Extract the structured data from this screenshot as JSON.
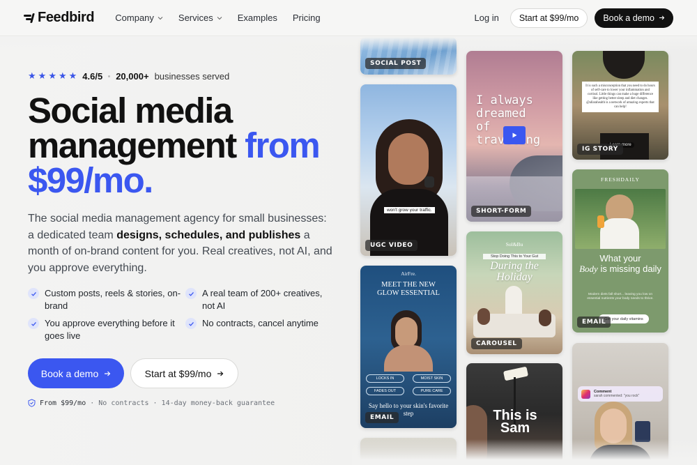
{
  "nav": {
    "brand": "Feedbird",
    "menu": [
      {
        "label": "Company",
        "dropdown": true
      },
      {
        "label": "Services",
        "dropdown": true
      },
      {
        "label": "Examples",
        "dropdown": false
      },
      {
        "label": "Pricing",
        "dropdown": false
      }
    ],
    "login": "Log in",
    "start_button": "Start at $99/mo",
    "demo_button": "Book a demo"
  },
  "hero": {
    "stars": 5,
    "rating": "4.6/5",
    "served_count": "20,000+",
    "served_text": "businesses served",
    "headline_line1": "Social media",
    "headline_line2a": "management ",
    "headline_line2b": "from",
    "headline_line3": "$99/mo.",
    "lead_start": "The social media management agency for small businesses: a dedicated team ",
    "lead_bold": "designs, schedules, and publishes",
    "lead_end": " a month of on-brand content for you. Real creatives, not AI, and you approve everything.",
    "features": [
      "Custom posts, reels & stories, on-brand",
      "A real team of 200+ creatives, not AI",
      "You approve everything before it goes live",
      "No contracts, cancel anytime"
    ],
    "primary_button": "Book a demo",
    "secondary_button": "Start at $99/mo",
    "fine_1": "From $99/mo",
    "fine_2": "No contracts",
    "fine_3": "14-day money-back guarantee",
    "fine_sep": "·"
  },
  "cards": {
    "social_post": "SOCIAL POST",
    "ugc_video": "UGC VIDEO",
    "ugc_caption": "won't grow your traffic.",
    "email_1": "EMAIL",
    "email_1_brand": "AirFre.",
    "email_1_title": "MEET THE NEW GLOW ESSENTIAL",
    "email_1_pills": [
      "LOCKS IN",
      "MOIST SKIN",
      "FADES OUT",
      "PURE CARE"
    ],
    "email_1_footer": "Say hello to your skin's favorite step",
    "short_form": "SHORT-FORM",
    "short_form_text": "I always dreamed of traveling",
    "carousel": "CAROUSEL",
    "carousel_brand": "Sol&Bu",
    "carousel_top": "Stop Doing This to Your Gut",
    "carousel_title": "During the Holiday",
    "sam_text": "This is Sam",
    "ig_story": "IG STORY",
    "ig_story_text": "It is such a misconception that you need to do hours of self-care to lower your inflammation and cortisol. Little things can make a huge difference like getting better sleep and diet changes. @allarahealth is a network of amazing experts that can help!",
    "ig_story_more": "Learn more",
    "email_2": "EMAIL",
    "email_2_brand": "FRESHDAILY",
    "email_2_title_a": "What your",
    "email_2_title_b": "Body",
    "email_2_title_c": "is missing daily",
    "email_2_body": "Modern diets fall short... leaving you low on essential nutrients your body needs to thrive.",
    "email_2_button": "Get your daily vitamins",
    "notif_title": "Comment",
    "notif_body": "sarah commented: \"you rock\""
  },
  "colors": {
    "accent": "#3b57f0",
    "dark": "#111111",
    "email_blue": "#234a78",
    "email_green": "#7d9a6d"
  }
}
